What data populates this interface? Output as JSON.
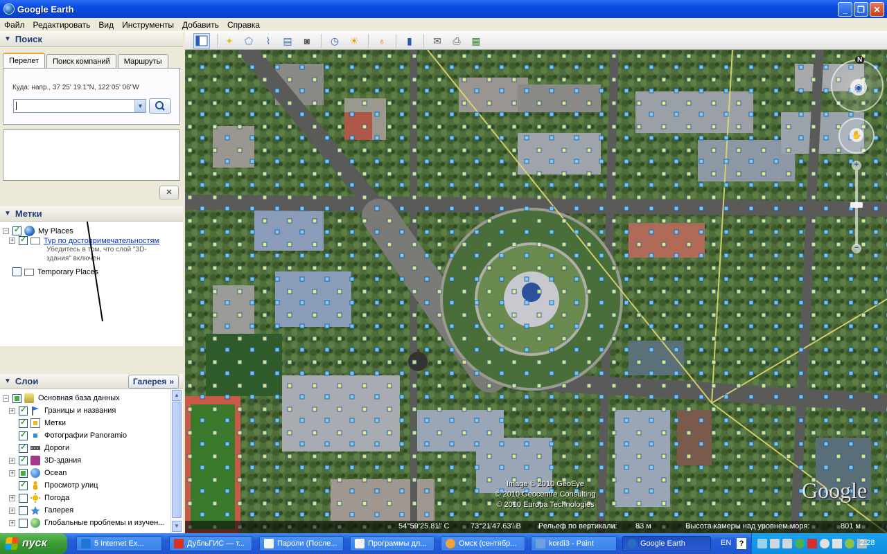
{
  "window": {
    "title": "Google Earth"
  },
  "menu": [
    "Файл",
    "Редактировать",
    "Вид",
    "Инструменты",
    "Добавить",
    "Справка"
  ],
  "search": {
    "header": "Поиск",
    "tabs": [
      "Перелет",
      "Поиск компаний",
      "Маршруты"
    ],
    "hint_label": "Куда:",
    "hint_example": "напр., 37 25' 19.1\"N, 122 05' 06\"W",
    "input_value": ""
  },
  "places": {
    "header": "Метки",
    "items": [
      {
        "label": "My Places",
        "checked": true
      },
      {
        "label": "Тур по достопримечательностям",
        "note": "Убедитесь в том, что слой \"3D-здания\" включен",
        "checked": true
      },
      {
        "label": "Temporary Places",
        "checked": false
      }
    ]
  },
  "layers": {
    "header": "Слои",
    "gallery_label": "Галерея",
    "items": [
      {
        "label": "Основная база данных",
        "state": "partial",
        "icon": "database-icon"
      },
      {
        "label": "Границы и названия",
        "state": "on",
        "icon": "flag-icon"
      },
      {
        "label": "Метки",
        "state": "on",
        "icon": "placemark-icon"
      },
      {
        "label": "Фотографии Panoramio",
        "state": "on",
        "icon": "photo-icon"
      },
      {
        "label": "Дороги",
        "state": "on",
        "icon": "road-icon"
      },
      {
        "label": "3D-здания",
        "state": "on",
        "icon": "building-icon"
      },
      {
        "label": "Ocean",
        "state": "partial",
        "icon": "ocean-icon"
      },
      {
        "label": "Просмотр улиц",
        "state": "on",
        "icon": "pegman-icon"
      },
      {
        "label": "Погода",
        "state": "off",
        "icon": "weather-icon"
      },
      {
        "label": "Галерея",
        "state": "off",
        "icon": "gallery-icon"
      },
      {
        "label": "Глобальные проблемы и изучен...",
        "state": "off",
        "icon": "globe-icon"
      }
    ]
  },
  "map": {
    "copyright": [
      "Image © 2010 GeoEye",
      "© 2010 Geocentre Consulting",
      "© 2010 Europa Technologies"
    ],
    "logo": "Google",
    "north": "N"
  },
  "status": {
    "lat": "54°59'25.81\" С",
    "lon": "73°21'47.63\" В",
    "elevation_label": "Рельеф по вертикали:",
    "elevation_value": "83 м",
    "eye_alt_label": "Высота камеры над уровнем моря:",
    "eye_alt_value": "801 м"
  },
  "taskbar": {
    "start_label": "пуск",
    "tasks": [
      {
        "label": "5 Internet Ex...",
        "color": "#1e77d8"
      },
      {
        "label": "ДубльГИС — т...",
        "color": "#d93025"
      },
      {
        "label": "Пароли (После...",
        "color": "#f5f5f5"
      },
      {
        "label": "Программы дл...",
        "color": "#f5f5f5"
      },
      {
        "label": "Омск (сентябр...",
        "color": "#f2a23a"
      },
      {
        "label": "kordi3 - Paint",
        "color": "#6ea0e0"
      },
      {
        "label": "Google Earth",
        "color": "#2a6bc4",
        "active": true
      }
    ],
    "lang": "EN",
    "clock": "2:28"
  }
}
